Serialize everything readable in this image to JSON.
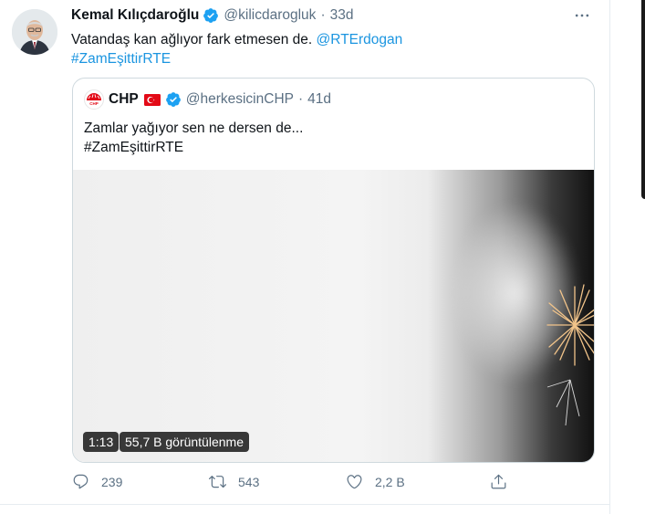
{
  "tweet": {
    "author_name": "Kemal Kılıçdaroğlu",
    "handle": "@kilicdarogluk",
    "separator": "·",
    "time": "33d",
    "text_before": "Vatandaş kan ağlıyor fark etmesen de. ",
    "mention": "@RTErdogan",
    "hashtag": "#ZamEşittirRTE",
    "more_icon": "more-horizontal-icon",
    "verified_icon": "verified-badge-icon"
  },
  "quoted": {
    "name": "CHP",
    "flag_icon": "turkey-flag-icon",
    "handle": "@herkesicinCHP",
    "separator": "·",
    "time": "41d",
    "text": "Zamlar yağıyor sen ne dersen de...",
    "hashtag": "#ZamEşittirRTE",
    "video": {
      "duration": "1:13",
      "views": "55,7 B görüntülenme"
    }
  },
  "actions": {
    "reply_count": "239",
    "retweet_count": "543",
    "like_count": "2,2 B",
    "share_icon": "share-icon"
  },
  "colors": {
    "accent": "#1b95e0",
    "muted": "#5b7083",
    "verified": "#1da1f2",
    "chp_red": "#e30a17"
  }
}
